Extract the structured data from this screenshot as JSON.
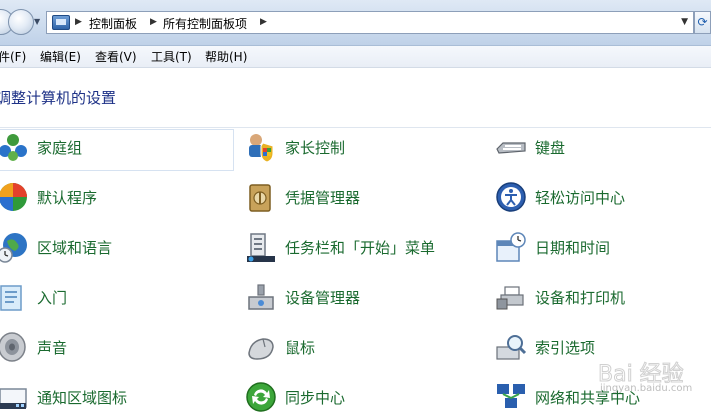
{
  "address": {
    "crumbs": [
      "控制面板",
      "所有控制面板项"
    ]
  },
  "menu": {
    "items": [
      "件(F)",
      "编辑(E)",
      "查看(V)",
      "工具(T)",
      "帮助(H)"
    ]
  },
  "page": {
    "title": "调整计算机的设置"
  },
  "items": {
    "col1": [
      {
        "label": "家庭组",
        "icon": "homegroup-icon"
      },
      {
        "label": "默认程序",
        "icon": "default-programs-icon"
      },
      {
        "label": "区域和语言",
        "icon": "region-language-icon"
      },
      {
        "label": "入门",
        "icon": "getting-started-icon"
      },
      {
        "label": "声音",
        "icon": "sound-icon"
      },
      {
        "label": "通知区域图标",
        "icon": "notification-area-icon"
      }
    ],
    "col2": [
      {
        "label": "家长控制",
        "icon": "parental-controls-icon"
      },
      {
        "label": "凭据管理器",
        "icon": "credential-manager-icon"
      },
      {
        "label": "任务栏和「开始」菜单",
        "icon": "taskbar-start-menu-icon"
      },
      {
        "label": "设备管理器",
        "icon": "device-manager-icon"
      },
      {
        "label": "鼠标",
        "icon": "mouse-icon"
      },
      {
        "label": "同步中心",
        "icon": "sync-center-icon"
      }
    ],
    "col3": [
      {
        "label": "键盘",
        "icon": "keyboard-icon"
      },
      {
        "label": "轻松访问中心",
        "icon": "ease-of-access-icon"
      },
      {
        "label": "日期和时间",
        "icon": "date-time-icon"
      },
      {
        "label": "设备和打印机",
        "icon": "devices-printers-icon"
      },
      {
        "label": "索引选项",
        "icon": "indexing-options-icon"
      },
      {
        "label": "网络和共享中心",
        "icon": "network-sharing-icon"
      }
    ]
  },
  "watermark": {
    "text": "Bai 经验",
    "sub": "jingyan.baidu.com"
  }
}
